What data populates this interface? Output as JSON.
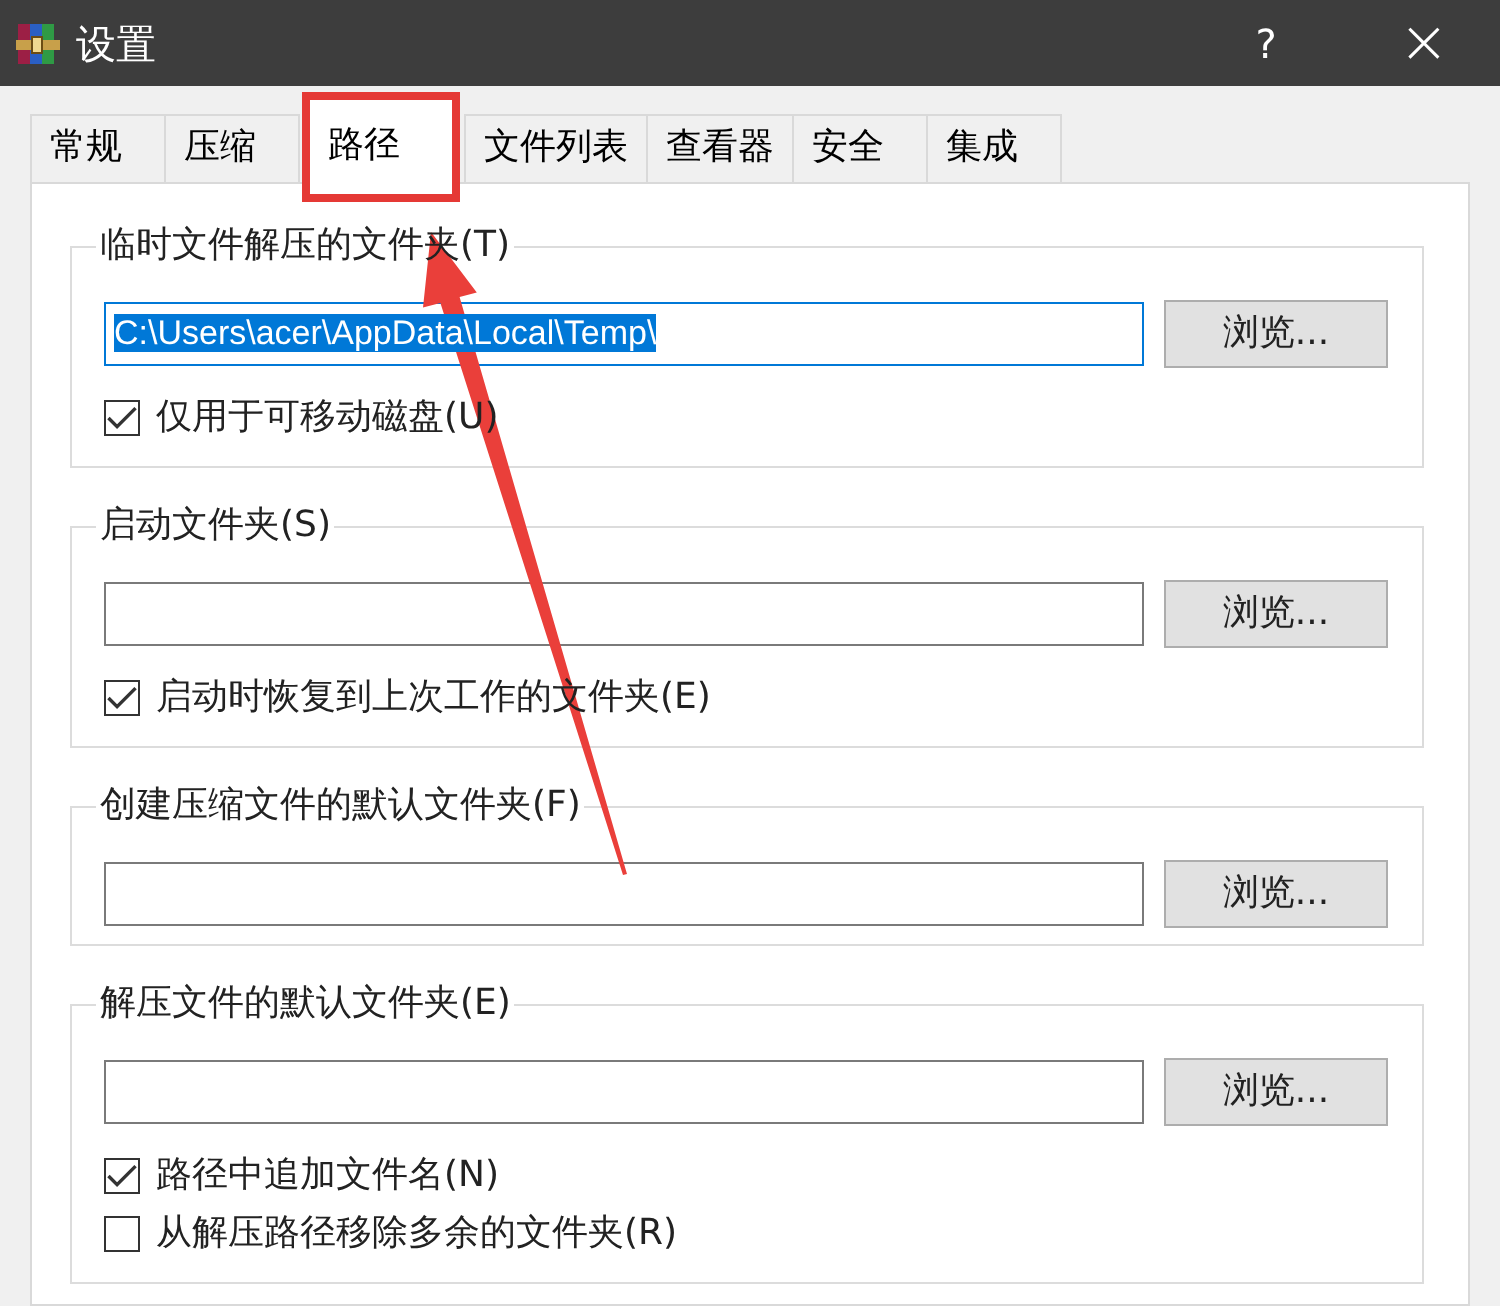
{
  "window": {
    "title": "设置",
    "help": "?",
    "close": "×"
  },
  "tabs": [
    {
      "label": "常规",
      "selected": false,
      "highlighted": false
    },
    {
      "label": "压缩",
      "selected": false,
      "highlighted": false
    },
    {
      "label": "路径",
      "selected": true,
      "highlighted": true
    },
    {
      "label": "文件列表",
      "selected": false,
      "highlighted": false
    },
    {
      "label": "查看器",
      "selected": false,
      "highlighted": false
    },
    {
      "label": "安全",
      "selected": false,
      "highlighted": false
    },
    {
      "label": "集成",
      "selected": false,
      "highlighted": false
    }
  ],
  "groups": [
    {
      "title": "临时文件解压的文件夹(T)",
      "field": {
        "value": "C:\\Users\\acer\\AppData\\Local\\Temp\\",
        "focused": true,
        "text_selected": true
      },
      "button": "浏览...",
      "options": [
        {
          "label": "仅用于可移动磁盘(U)",
          "checked": true
        }
      ]
    },
    {
      "title": "启动文件夹(S)",
      "field": {
        "focused": false
      },
      "button": "浏览...",
      "options": [
        {
          "label": "启动时恢复到上次工作的文件夹(E)",
          "checked": true
        }
      ]
    },
    {
      "title": "创建压缩文件的默认文件夹(F)",
      "field": {
        "focused": false
      },
      "button": "浏览..."
    },
    {
      "title": "解压文件的默认文件夹(E)",
      "field": {
        "focused": false
      },
      "button": "浏览...",
      "options": [
        {
          "label": "路径中追加文件名(N)",
          "checked": true
        },
        {
          "label": "从解压路径移除多余的文件夹(R)",
          "checked": false
        }
      ]
    }
  ],
  "annotations": [
    {
      "kind": "arrow"
    }
  ]
}
